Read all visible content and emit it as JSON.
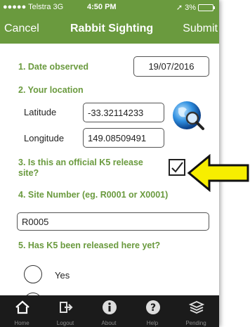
{
  "status_bar": {
    "carrier": "●●●●● Telstra  3G",
    "time": "4:50 PM",
    "battery_percent": "3%"
  },
  "nav": {
    "cancel_label": "Cancel",
    "title": "Rabbit Sighting",
    "submit_label": "Submit"
  },
  "form": {
    "q1_label": "1. Date observed",
    "date_value": "19/07/2016",
    "q2_label": "2. Your location",
    "latitude_label": "Latitude",
    "latitude_value": "-33.32114233",
    "longitude_label": "Longitude",
    "longitude_value": "149.08509491",
    "q3_label_line1": "3. Is this an official K5 release",
    "q3_label_line2": "site?",
    "q3_checked": true,
    "q4_label": "4. Site Number (eg. R0001 or X0001)",
    "site_number_value": "R0005",
    "q5_label": "5. Has K5 been released here yet?",
    "option_yes": "Yes"
  },
  "tab_bar": {
    "home": "Home",
    "logout": "Logout",
    "about": "About",
    "help": "Help",
    "pending": "Pending"
  },
  "colors": {
    "brand_green": "#6a9a3e",
    "arrow_yellow": "#f7ee00",
    "tab_bar": "#1b1b1b"
  },
  "icons": [
    "home-icon",
    "logout-icon",
    "info-icon",
    "help-icon",
    "pending-icon",
    "locate-globe-icon",
    "callout-arrow-icon"
  ]
}
